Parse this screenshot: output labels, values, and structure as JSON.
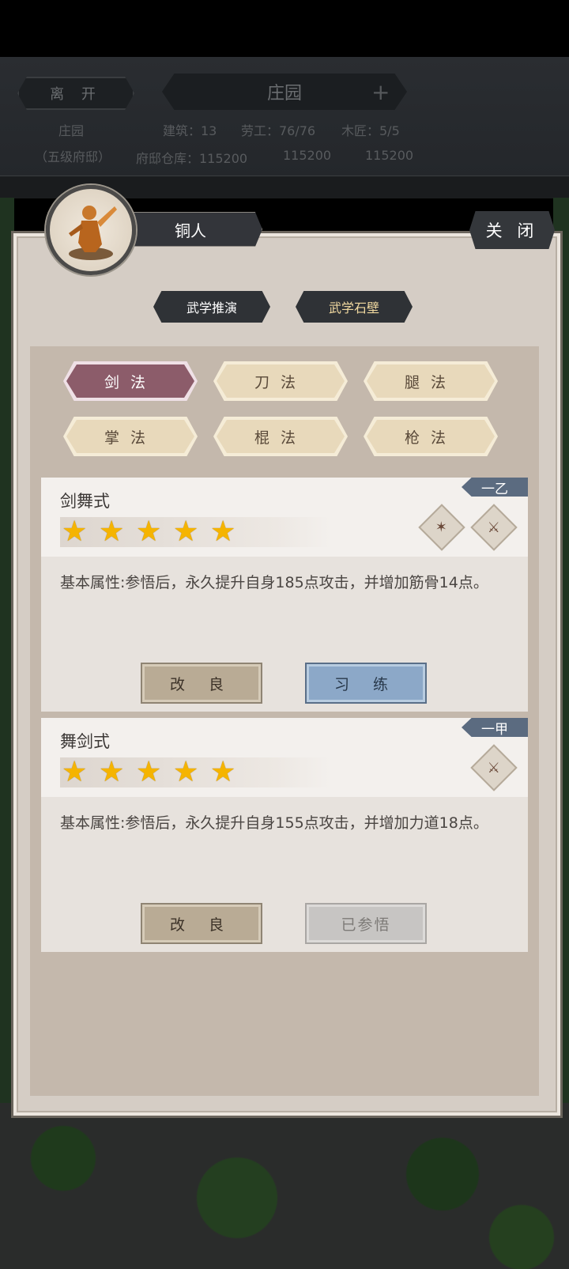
{
  "header": {
    "leave_label": "离 开",
    "estate_title": "庄园",
    "estate_name": "庄园",
    "estate_level": "（五级府邸）",
    "buildings": "建筑：13",
    "laborers": "劳工：76/76",
    "carpenters": "木匠：5/5",
    "warehouse_label": "府邸仓库：115200",
    "resource_2": "115200",
    "resource_3": "115200"
  },
  "panel": {
    "title": "铜人",
    "close_label": "关 闭",
    "tabs": [
      {
        "label": "武学推演",
        "active": true
      },
      {
        "label": "武学石壁",
        "active": false
      }
    ],
    "categories": [
      {
        "label": "剑法",
        "active": true
      },
      {
        "label": "刀法",
        "active": false
      },
      {
        "label": "腿法",
        "active": false
      },
      {
        "label": "掌法",
        "active": false
      },
      {
        "label": "棍法",
        "active": false
      },
      {
        "label": "枪法",
        "active": false
      }
    ]
  },
  "skills": [
    {
      "name": "剑舞式",
      "rank": "一乙",
      "stars": 5,
      "description": "基本属性:参悟后，永久提升自身185点攻击，并增加筋骨14点。",
      "improve_label": "改 良",
      "action_label": "习 练",
      "icons": [
        "shuriken-icon",
        "sword-icon"
      ]
    },
    {
      "name": "舞剑式",
      "rank": "一甲",
      "stars": 5,
      "description": "基本属性:参悟后，永久提升自身155点攻击，并增加力道18点。",
      "improve_label": "改 良",
      "action_label": "已参悟",
      "icons": [
        "sword-icon"
      ]
    }
  ],
  "colors": {
    "active_category": "#8c5c6a",
    "rank_badge": "#5b6b80",
    "practice_button": "#8ca8c8"
  }
}
